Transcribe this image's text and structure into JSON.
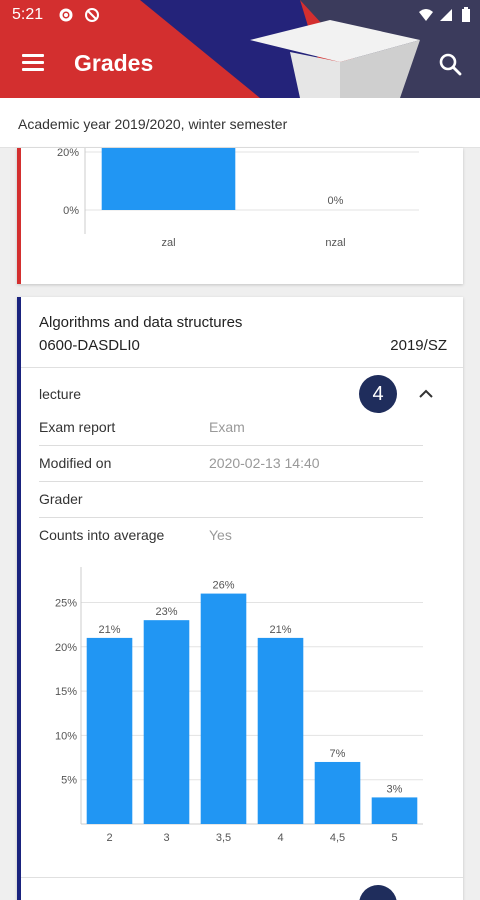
{
  "status_bar": {
    "time": "5:21"
  },
  "toolbar": {
    "title": "Grades"
  },
  "subtitle": "Academic year 2019/2020, winter semester",
  "colors": {
    "appbar": "#d32f2f",
    "bar": "#2196f3",
    "badge": "#1f2d5c",
    "prev_card_accent": "#d32f2f",
    "main_card_accent": "#1a237e"
  },
  "icons": [
    "gear-icon",
    "dnd-icon",
    "wifi-icon",
    "signal-icon",
    "battery-icon",
    "menu-icon",
    "search-icon",
    "chevron-up-icon"
  ],
  "previous_card": {
    "chart_data": {
      "type": "bar",
      "categories": [
        "zal",
        "nzal"
      ],
      "values": [
        29,
        0
      ],
      "value_labels": [
        "",
        "0%"
      ],
      "y_ticks": [
        "20%",
        "0%"
      ],
      "y_tick_values": [
        20,
        0
      ]
    }
  },
  "course": {
    "name": "Algorithms and data structures",
    "code": "0600-DASDLI0",
    "term": "2019/SZ",
    "section_type": "lecture",
    "grade": "4",
    "details": [
      {
        "label": "Exam report",
        "value": "Exam"
      },
      {
        "label": "Modified on",
        "value": "2020-02-13 14:40"
      },
      {
        "label": "Grader",
        "value": ""
      },
      {
        "label": "Counts into average",
        "value": "Yes"
      }
    ]
  },
  "chart_data": {
    "type": "bar",
    "categories": [
      "2",
      "3",
      "3,5",
      "4",
      "4,5",
      "5"
    ],
    "values": [
      21,
      23,
      26,
      21,
      7,
      3
    ],
    "value_labels": [
      "21%",
      "23%",
      "26%",
      "21%",
      "7%",
      "3%"
    ],
    "y_ticks": [
      "25%",
      "20%",
      "15%",
      "10%",
      "5%"
    ],
    "y_tick_values": [
      25,
      20,
      15,
      10,
      5
    ],
    "ylim": [
      0,
      29
    ]
  }
}
